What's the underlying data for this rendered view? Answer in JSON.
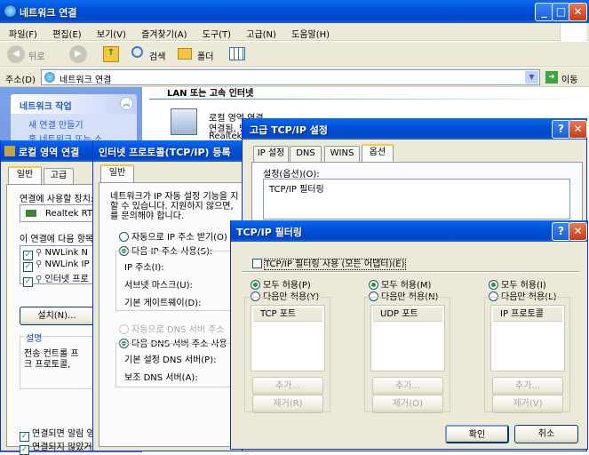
{
  "main": {
    "title": "네트워크 연결",
    "menu": [
      "파일(F)",
      "편집(E)",
      "보기(V)",
      "즐겨찾기(A)",
      "도구(T)",
      "고급(N)",
      "도움말(H)"
    ],
    "toolbar": {
      "back": "뒤로",
      "search": "검색",
      "folders": "폴더"
    },
    "address_label": "주소(D)",
    "address_value": "네트워크 연결",
    "go": "이동",
    "side_title": "네트워크 작업",
    "side_items": [
      "새 연결 만들기",
      "홈 네트워크 또는 소"
    ],
    "group_header": "LAN 또는 고속 인터넷",
    "conn_name": "로컬 영역 연결",
    "conn_status": "연결됨, 방",
    "conn_device": "Realtek"
  },
  "lan_props": {
    "title": "로컬 영역 연결",
    "tabs": [
      "일반",
      "고급"
    ],
    "connect_using": "연결에 사용할 장치:",
    "adapter": "Realtek RT",
    "items_label": "이 연결에 다음 항목",
    "items": [
      "NWLink N",
      "NWLink IP",
      "인터넷 프로"
    ],
    "install": "설치(N)...",
    "desc_group": "설명",
    "desc_text": [
      "전송 컨트롤 프",
      "크 프로토콜,"
    ],
    "opt1": "연결되면 알림 영",
    "opt2": "연결되지 않았거"
  },
  "tcpip": {
    "title": "인터넷 프로토콜(TCP/IP) 등록",
    "tab": "일반",
    "intro": [
      "네트워크가 IP 자동 설정 기능을 지",
      "할 수 있습니다. 지원하지 않으면,",
      "를 문의해야 합니다."
    ],
    "auto_ip": "자동으로 IP 주소 받기(O)",
    "use_ip": "다음 IP 주소 사용(S):",
    "ip_label": "IP 주소(I):",
    "mask_label": "서브넷 마스크(U):",
    "gw_label": "기본 게이트웨이(D):",
    "auto_dns": "자동으로 DNS 서버 주소",
    "use_dns": "다음 DNS 서버 주소 사용",
    "pref_dns": "기본 설정 DNS 서버(P):",
    "alt_dns": "보조 DNS 서버(A):"
  },
  "advanced": {
    "title": "고급 TCP/IP 설정",
    "tabs": [
      "IP 설정",
      "DNS",
      "WINS",
      "옵션"
    ],
    "settings_label": "설정(옵션)(O):",
    "settings_item": "TCP/IP 필터링"
  },
  "filter": {
    "title": "TCP/IP 필터링",
    "enable_all": "TCP/IP 필터링 사용 (모든 어댑터)(E)",
    "groups": [
      {
        "allow_all": "모두 허용(P)",
        "allow_only": "다음만 허용(Y)",
        "header": "TCP 포트",
        "add": "추가...",
        "remove": "제거(R)"
      },
      {
        "allow_all": "모두 허용(M)",
        "allow_only": "다음만 허용(N)",
        "header": "UDP 포트",
        "add": "추가...",
        "remove": "제거(O)"
      },
      {
        "allow_all": "모두 허용(I)",
        "allow_only": "다음만 허용(L)",
        "header": "IP 프로토콜",
        "add": "추가...",
        "remove": "제거(V)"
      }
    ],
    "ok": "확인",
    "cancel": "취소"
  }
}
